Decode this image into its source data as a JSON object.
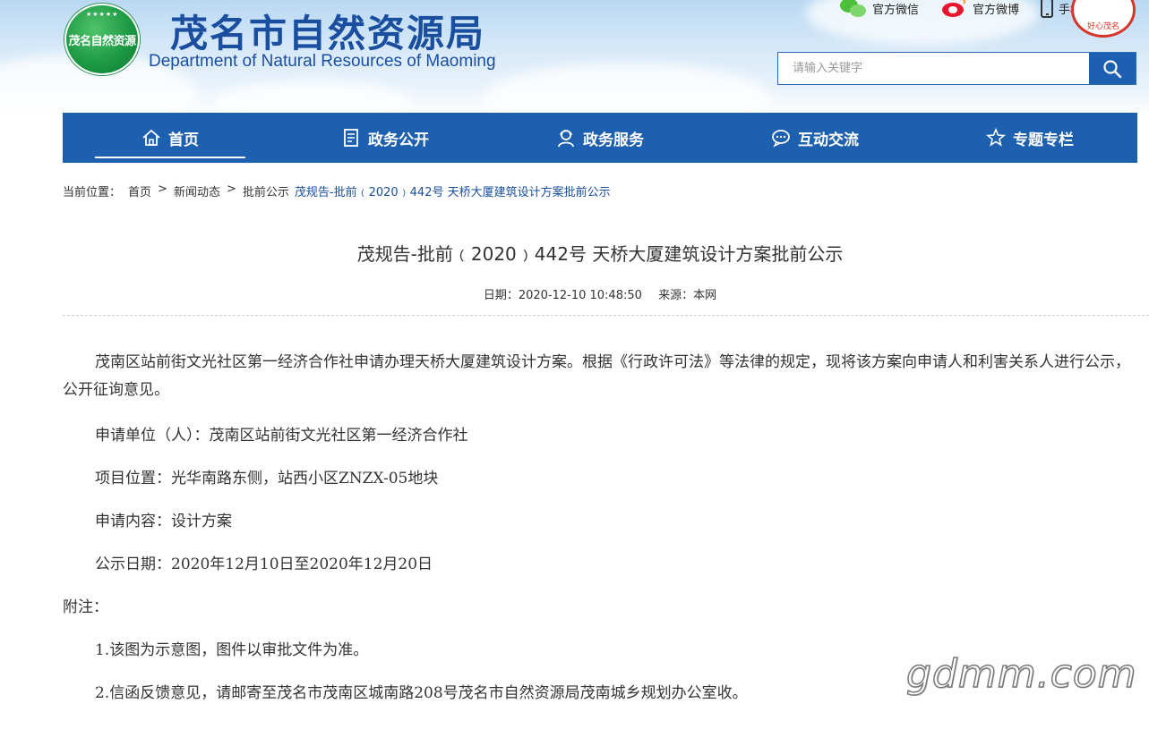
{
  "header": {
    "logo_text": "茂名自然资源",
    "title_cn": "茂名市自然资源局",
    "title_en": "Department of Natural Resources of Maoming",
    "top_links": [
      {
        "icon": "wechat-icon",
        "label": "官方微信"
      },
      {
        "icon": "weibo-icon",
        "label": "官方微博"
      },
      {
        "icon": "phone-icon",
        "label": "手机端"
      }
    ],
    "badge_text": "好心茂名",
    "search": {
      "placeholder": "请输入关键字",
      "icon": "search-icon"
    }
  },
  "nav": {
    "items": [
      {
        "label": "首页",
        "icon": "home-icon",
        "active": true
      },
      {
        "label": "政务公开",
        "icon": "document-icon",
        "active": false
      },
      {
        "label": "政务服务",
        "icon": "service-person-icon",
        "active": false
      },
      {
        "label": "互动交流",
        "icon": "chat-icon",
        "active": false
      },
      {
        "label": "专题专栏",
        "icon": "star-badge-icon",
        "active": false
      }
    ]
  },
  "breadcrumb": {
    "prefix": "当前位置：",
    "items": [
      "首页",
      "新闻动态",
      "批前公示"
    ],
    "current": "茂规告-批前﹙2020﹚442号 天桥大厦建筑设计方案批前公示",
    "separator": ">"
  },
  "article": {
    "title": "茂规告-批前﹙2020﹚442号 天桥大厦建筑设计方案批前公示",
    "date_label": "日期：2020-12-10 10:48:50",
    "source_label": "来源：本网",
    "intro": "茂南区站前街文光社区第一经济合作社申请办理天桥大厦建筑设计方案。根据《行政许可法》等法律的规定，现将该方案向申请人和利害关系人进行公示，公开征询意见。",
    "applicant": "申请单位（人）：茂南区站前街文光社区第一经济合作社",
    "location": "项目位置：光华南路东侧，站西小区ZNZX-05地块",
    "content": "申请内容：设计方案",
    "period": "公示日期：2020年12月10日至2020年12月20日",
    "notes_title": "附注：",
    "note1": "1.该图为示意图，图件以审批文件为准。",
    "note2": "2.信函反馈意见，请邮寄至茂名市茂南区城南路208号茂名市自然资源局茂南城乡规划办公室收。"
  },
  "watermark": "gdmm.com",
  "colors": {
    "brand_blue": "#1e60b0",
    "title_blue": "#1a4fa0",
    "logo_green": "#1d9a44",
    "badge_red": "#d8352a"
  }
}
